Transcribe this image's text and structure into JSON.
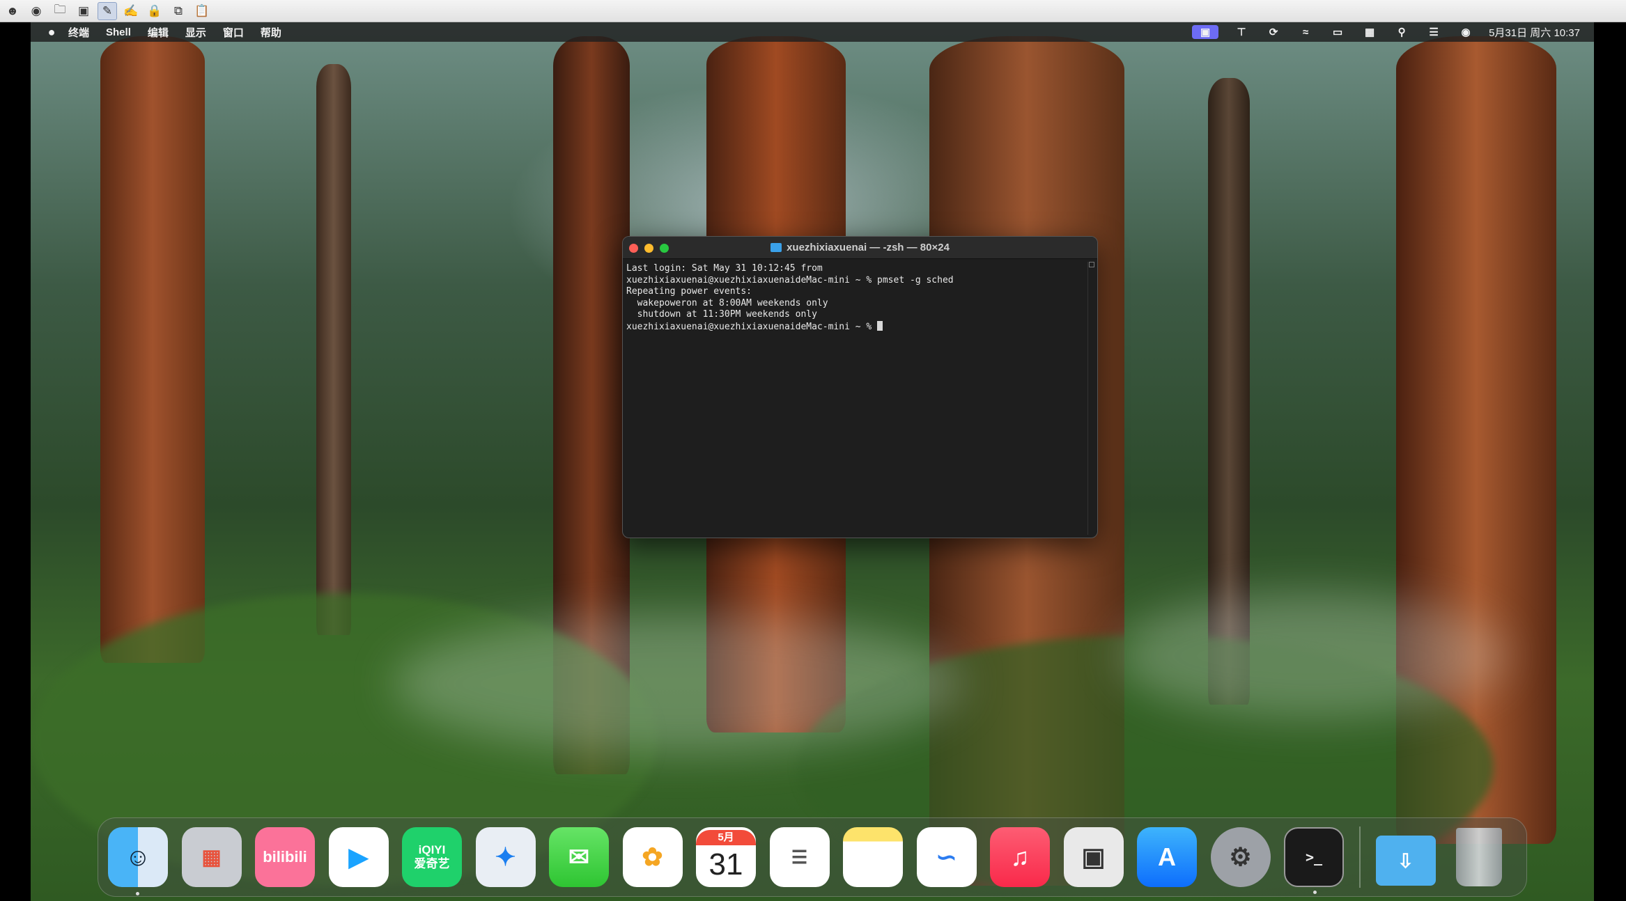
{
  "viewer_toolbar": {
    "icons": [
      "user-icon",
      "eye-icon",
      "folder-icon",
      "screen-icon",
      "remote-control-icon",
      "remote-control-alt-icon",
      "lock-icon",
      "copy-icon",
      "clipboard-icon"
    ]
  },
  "menubar": {
    "apple": "",
    "items": [
      "终端",
      "Shell",
      "编辑",
      "显示",
      "窗口",
      "帮助"
    ],
    "clock": "5月31日 周六 10:37"
  },
  "terminal": {
    "title": "xuezhixiaxuenai — -zsh — 80×24",
    "lines": [
      "Last login: Sat May 31 10:12:45 from",
      "xuezhixiaxuenai@xuezhixiaxuenaideMac-mini ~ % pmset -g sched",
      "Repeating power events:",
      "  wakepoweron at 8:00AM weekends only",
      "  shutdown at 11:30PM weekends only",
      "xuezhixiaxuenai@xuezhixiaxuenaideMac-mini ~ % "
    ]
  },
  "dock": {
    "bilibili": "bilibili",
    "iqiyi_top": "iQIYI",
    "iqiyi_bottom": "爱奇艺",
    "calendar_month": "5月",
    "calendar_day": "31",
    "terminal_prompt": ">_"
  },
  "colors": {
    "accent": "#6d6cf4",
    "terminal_bg": "#1e1e1e"
  }
}
